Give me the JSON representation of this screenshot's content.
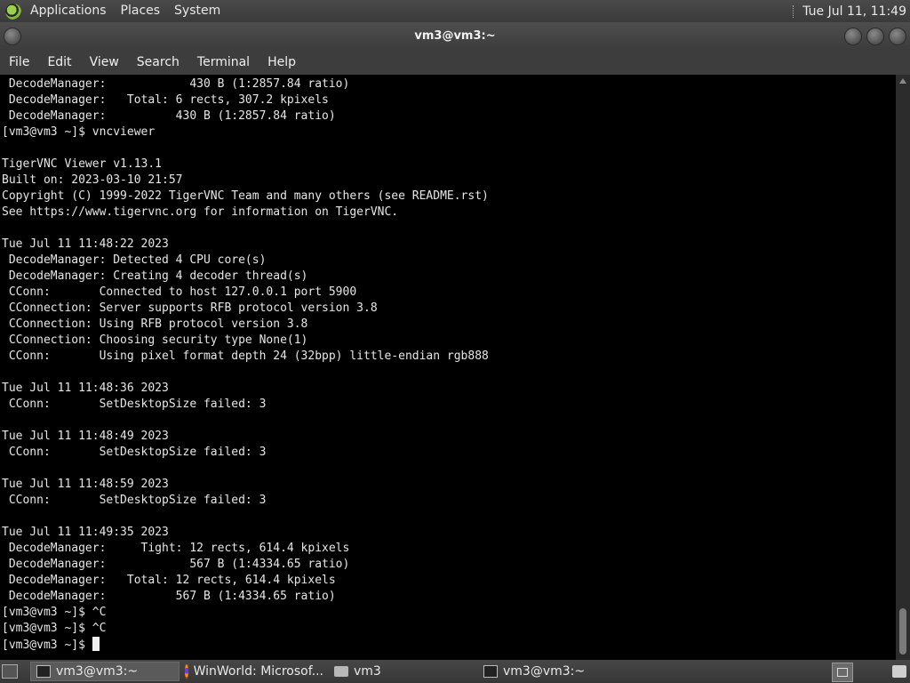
{
  "top_panel": {
    "menus": [
      "Applications",
      "Places",
      "System"
    ],
    "clock": "Tue Jul 11, 11:49"
  },
  "window": {
    "title": "vm3@vm3:~"
  },
  "menubar": [
    "File",
    "Edit",
    "View",
    "Search",
    "Terminal",
    "Help"
  ],
  "terminal": {
    "lines": [
      " DecodeManager:            430 B (1:2857.84 ratio)",
      " DecodeManager:   Total: 6 rects, 307.2 kpixels",
      " DecodeManager:          430 B (1:2857.84 ratio)",
      "[vm3@vm3 ~]$ vncviewer",
      "",
      "TigerVNC Viewer v1.13.1",
      "Built on: 2023-03-10 21:57",
      "Copyright (C) 1999-2022 TigerVNC Team and many others (see README.rst)",
      "See https://www.tigervnc.org for information on TigerVNC.",
      "",
      "Tue Jul 11 11:48:22 2023",
      " DecodeManager: Detected 4 CPU core(s)",
      " DecodeManager: Creating 4 decoder thread(s)",
      " CConn:       Connected to host 127.0.0.1 port 5900",
      " CConnection: Server supports RFB protocol version 3.8",
      " CConnection: Using RFB protocol version 3.8",
      " CConnection: Choosing security type None(1)",
      " CConn:       Using pixel format depth 24 (32bpp) little-endian rgb888",
      "",
      "Tue Jul 11 11:48:36 2023",
      " CConn:       SetDesktopSize failed: 3",
      "",
      "Tue Jul 11 11:48:49 2023",
      " CConn:       SetDesktopSize failed: 3",
      "",
      "Tue Jul 11 11:48:59 2023",
      " CConn:       SetDesktopSize failed: 3",
      "",
      "Tue Jul 11 11:49:35 2023",
      " DecodeManager:     Tight: 12 rects, 614.4 kpixels",
      " DecodeManager:            567 B (1:4334.65 ratio)",
      " DecodeManager:   Total: 12 rects, 614.4 kpixels",
      " DecodeManager:          567 B (1:4334.65 ratio)",
      "[vm3@vm3 ~]$ ^C",
      "[vm3@vm3 ~]$ ^C"
    ],
    "prompt": "[vm3@vm3 ~]$ "
  },
  "taskbar": {
    "tasks": [
      {
        "label": "vm3@vm3:~",
        "icon": "terminal-icon",
        "active": true
      },
      {
        "label": "WinWorld: Microsof...",
        "icon": "firefox-icon",
        "active": false
      },
      {
        "label": "vm3",
        "icon": "folder-icon",
        "active": false
      },
      {
        "label": "vm3@vm3:~",
        "icon": "terminal-icon",
        "active": false
      }
    ]
  }
}
